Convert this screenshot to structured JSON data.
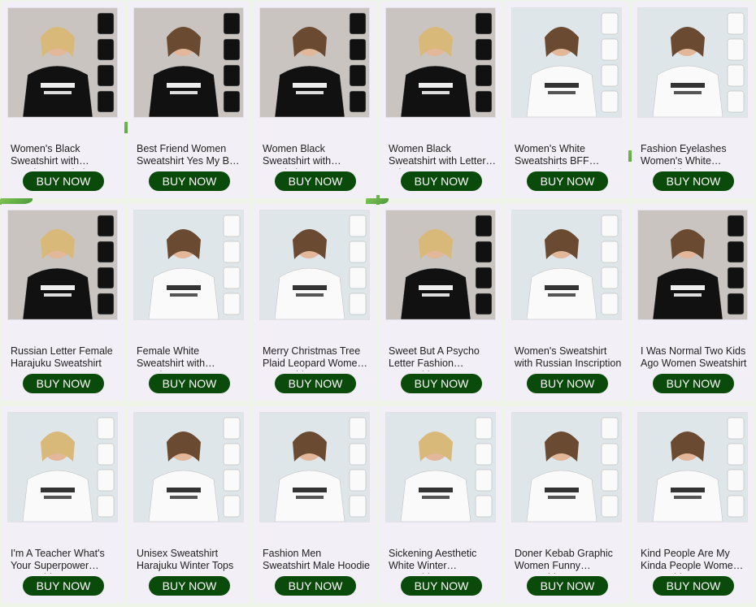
{
  "products": [
    {
      "title": "Women's Black Sweatshirt with Russian Inscription",
      "button": "BUY NOW",
      "theme": "dark"
    },
    {
      "title": "Best Friend Women Sweatshirt Yes My BFF Is Crazy",
      "button": "BUY NOW",
      "theme": "dark"
    },
    {
      "title": "Women Black Sweatshirt with Inscription",
      "button": "BUY NOW",
      "theme": "dark"
    },
    {
      "title": "Women Black Sweatshirt with Letter Print",
      "button": "BUY NOW",
      "theme": "dark"
    },
    {
      "title": "Women's White Sweatshirts BFF Burger Fries",
      "button": "BUY NOW",
      "theme": "light"
    },
    {
      "title": "Fashion Eyelashes Women's White Sweatshirt",
      "button": "BUY NOW",
      "theme": "light"
    },
    {
      "title": "Russian Letter Female Harajuku Sweatshirt",
      "button": "BUY NOW",
      "theme": "dark"
    },
    {
      "title": "Female White Sweatshirt with Russian Letters",
      "button": "BUY NOW",
      "theme": "light"
    },
    {
      "title": "Merry Christmas Tree Plaid Leopard Women Sweatshirt",
      "button": "BUY NOW",
      "theme": "light"
    },
    {
      "title": "Sweet But A Psycho Letter Fashion Sweatshirt",
      "button": "BUY NOW",
      "theme": "dark"
    },
    {
      "title": "Women's Sweatshirt with Russian Inscription",
      "button": "BUY NOW",
      "theme": "light"
    },
    {
      "title": "I Was Normal Two Kids Ago Women Sweatshirt",
      "button": "BUY NOW",
      "theme": "dark"
    },
    {
      "title": "I'm A Teacher What's Your Superpower Sweatshirt",
      "button": "BUY NOW",
      "theme": "light"
    },
    {
      "title": "Unisex Sweatshirt Harajuku Winter Tops",
      "button": "BUY NOW",
      "theme": "light"
    },
    {
      "title": "Fashion Men Sweatshirt Male Hoodie",
      "button": "BUY NOW",
      "theme": "light"
    },
    {
      "title": "Sickening Aesthetic White Winter Sweatshirt",
      "button": "BUY NOW",
      "theme": "light"
    },
    {
      "title": "Doner Kebab Graphic Women Funny Sweatshirt",
      "button": "BUY NOW",
      "theme": "light"
    },
    {
      "title": "Kind People Are My Kinda People Women Sweatshirt",
      "button": "BUY NOW",
      "theme": "light"
    }
  ],
  "colors": {
    "button_bg": "#0a4a0a",
    "card_bg": "#f3eff6",
    "page_bg": "#eef4e8"
  }
}
